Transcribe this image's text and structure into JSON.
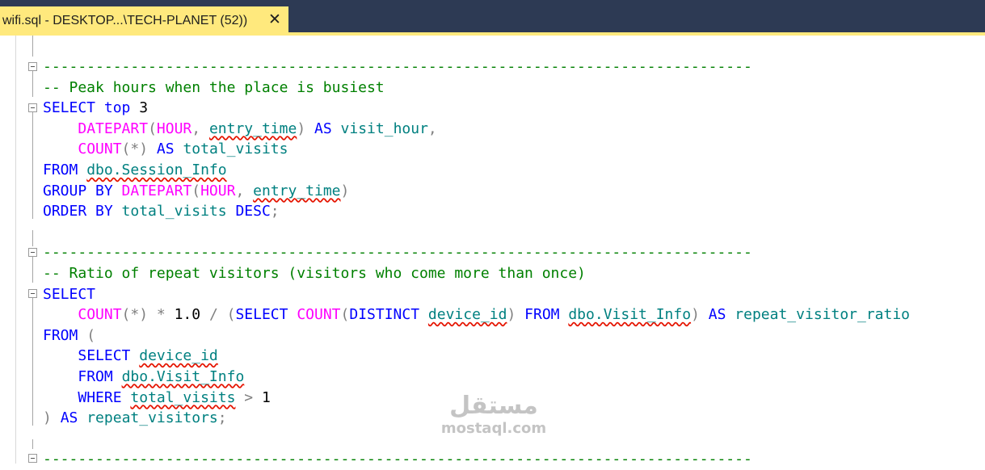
{
  "tab": {
    "title": "wifi.sql - DESKTOP...\\TECH-PLANET (52))",
    "close_glyph": "✕"
  },
  "editor": {
    "lines": [
      [
        [
          "cm",
          "---------------------------------------------------------------------------------"
        ]
      ],
      [
        [
          "cm",
          "-- Peak hours when the place is busiest"
        ]
      ],
      [
        [
          "kw",
          "SELECT"
        ],
        [
          "nm",
          " "
        ],
        [
          "kw",
          "top"
        ],
        [
          "nm",
          " 3"
        ]
      ],
      [
        [
          "nm",
          "    "
        ],
        [
          "fn",
          "DATEPART"
        ],
        [
          "op",
          "("
        ],
        [
          "fn",
          "HOUR"
        ],
        [
          "op",
          ", "
        ],
        [
          "id",
          "entry_time",
          "sq"
        ],
        [
          "op",
          ")"
        ],
        [
          "nm",
          " "
        ],
        [
          "kw",
          "AS"
        ],
        [
          "nm",
          " "
        ],
        [
          "id",
          "visit_hour"
        ],
        [
          "op",
          ","
        ]
      ],
      [
        [
          "nm",
          "    "
        ],
        [
          "fn",
          "COUNT"
        ],
        [
          "op",
          "(*)"
        ],
        [
          "nm",
          " "
        ],
        [
          "kw",
          "AS"
        ],
        [
          "nm",
          " "
        ],
        [
          "id",
          "total_visits"
        ]
      ],
      [
        [
          "kw",
          "FROM"
        ],
        [
          "nm",
          " "
        ],
        [
          "id",
          "dbo.Session_Info",
          "sq"
        ]
      ],
      [
        [
          "kw",
          "GROUP BY"
        ],
        [
          "nm",
          " "
        ],
        [
          "fn",
          "DATEPART"
        ],
        [
          "op",
          "("
        ],
        [
          "fn",
          "HOUR"
        ],
        [
          "op",
          ", "
        ],
        [
          "id",
          "entry_time",
          "sq"
        ],
        [
          "op",
          ")"
        ]
      ],
      [
        [
          "kw",
          "ORDER BY"
        ],
        [
          "nm",
          " "
        ],
        [
          "id",
          "total_visits"
        ],
        [
          "nm",
          " "
        ],
        [
          "kw",
          "DESC"
        ],
        [
          "op",
          ";"
        ]
      ],
      [],
      [
        [
          "cm",
          "---------------------------------------------------------------------------------"
        ]
      ],
      [
        [
          "cm",
          "-- Ratio of repeat visitors (visitors who come more than once)"
        ]
      ],
      [
        [
          "kw",
          "SELECT"
        ]
      ],
      [
        [
          "nm",
          "    "
        ],
        [
          "fn",
          "COUNT"
        ],
        [
          "op",
          "(*)"
        ],
        [
          "nm",
          " "
        ],
        [
          "op",
          "*"
        ],
        [
          "nm",
          " 1.0 "
        ],
        [
          "op",
          "/ ("
        ],
        [
          "kw",
          "SELECT"
        ],
        [
          "nm",
          " "
        ],
        [
          "fn",
          "COUNT"
        ],
        [
          "op",
          "("
        ],
        [
          "kw",
          "DISTINCT"
        ],
        [
          "nm",
          " "
        ],
        [
          "id",
          "device_id",
          "sq"
        ],
        [
          "op",
          ")"
        ],
        [
          "nm",
          " "
        ],
        [
          "kw",
          "FROM"
        ],
        [
          "nm",
          " "
        ],
        [
          "id",
          "dbo.Visit_Info",
          "sq"
        ],
        [
          "op",
          ")"
        ],
        [
          "nm",
          " "
        ],
        [
          "kw",
          "AS"
        ],
        [
          "nm",
          " "
        ],
        [
          "id",
          "repeat_visitor_ratio"
        ]
      ],
      [
        [
          "kw",
          "FROM"
        ],
        [
          "nm",
          " "
        ],
        [
          "op",
          "("
        ]
      ],
      [
        [
          "nm",
          "    "
        ],
        [
          "kw",
          "SELECT"
        ],
        [
          "nm",
          " "
        ],
        [
          "id",
          "device_id",
          "sq"
        ]
      ],
      [
        [
          "nm",
          "    "
        ],
        [
          "kw",
          "FROM"
        ],
        [
          "nm",
          " "
        ],
        [
          "id",
          "dbo.Visit_Info",
          "sq"
        ]
      ],
      [
        [
          "nm",
          "    "
        ],
        [
          "kw",
          "WHERE"
        ],
        [
          "nm",
          " "
        ],
        [
          "id",
          "total_visits",
          "sq"
        ],
        [
          "nm",
          " "
        ],
        [
          "op",
          ">"
        ],
        [
          "nm",
          " 1"
        ]
      ],
      [
        [
          "op",
          ")"
        ],
        [
          "nm",
          " "
        ],
        [
          "kw",
          "AS"
        ],
        [
          "nm",
          " "
        ],
        [
          "id",
          "repeat_visitors"
        ],
        [
          "op",
          ";"
        ]
      ],
      [],
      [
        [
          "cm",
          "---------------------------------------------------------------------------------"
        ]
      ]
    ]
  },
  "watermark": {
    "logo": "مستقل",
    "text": "mostaql.com"
  }
}
